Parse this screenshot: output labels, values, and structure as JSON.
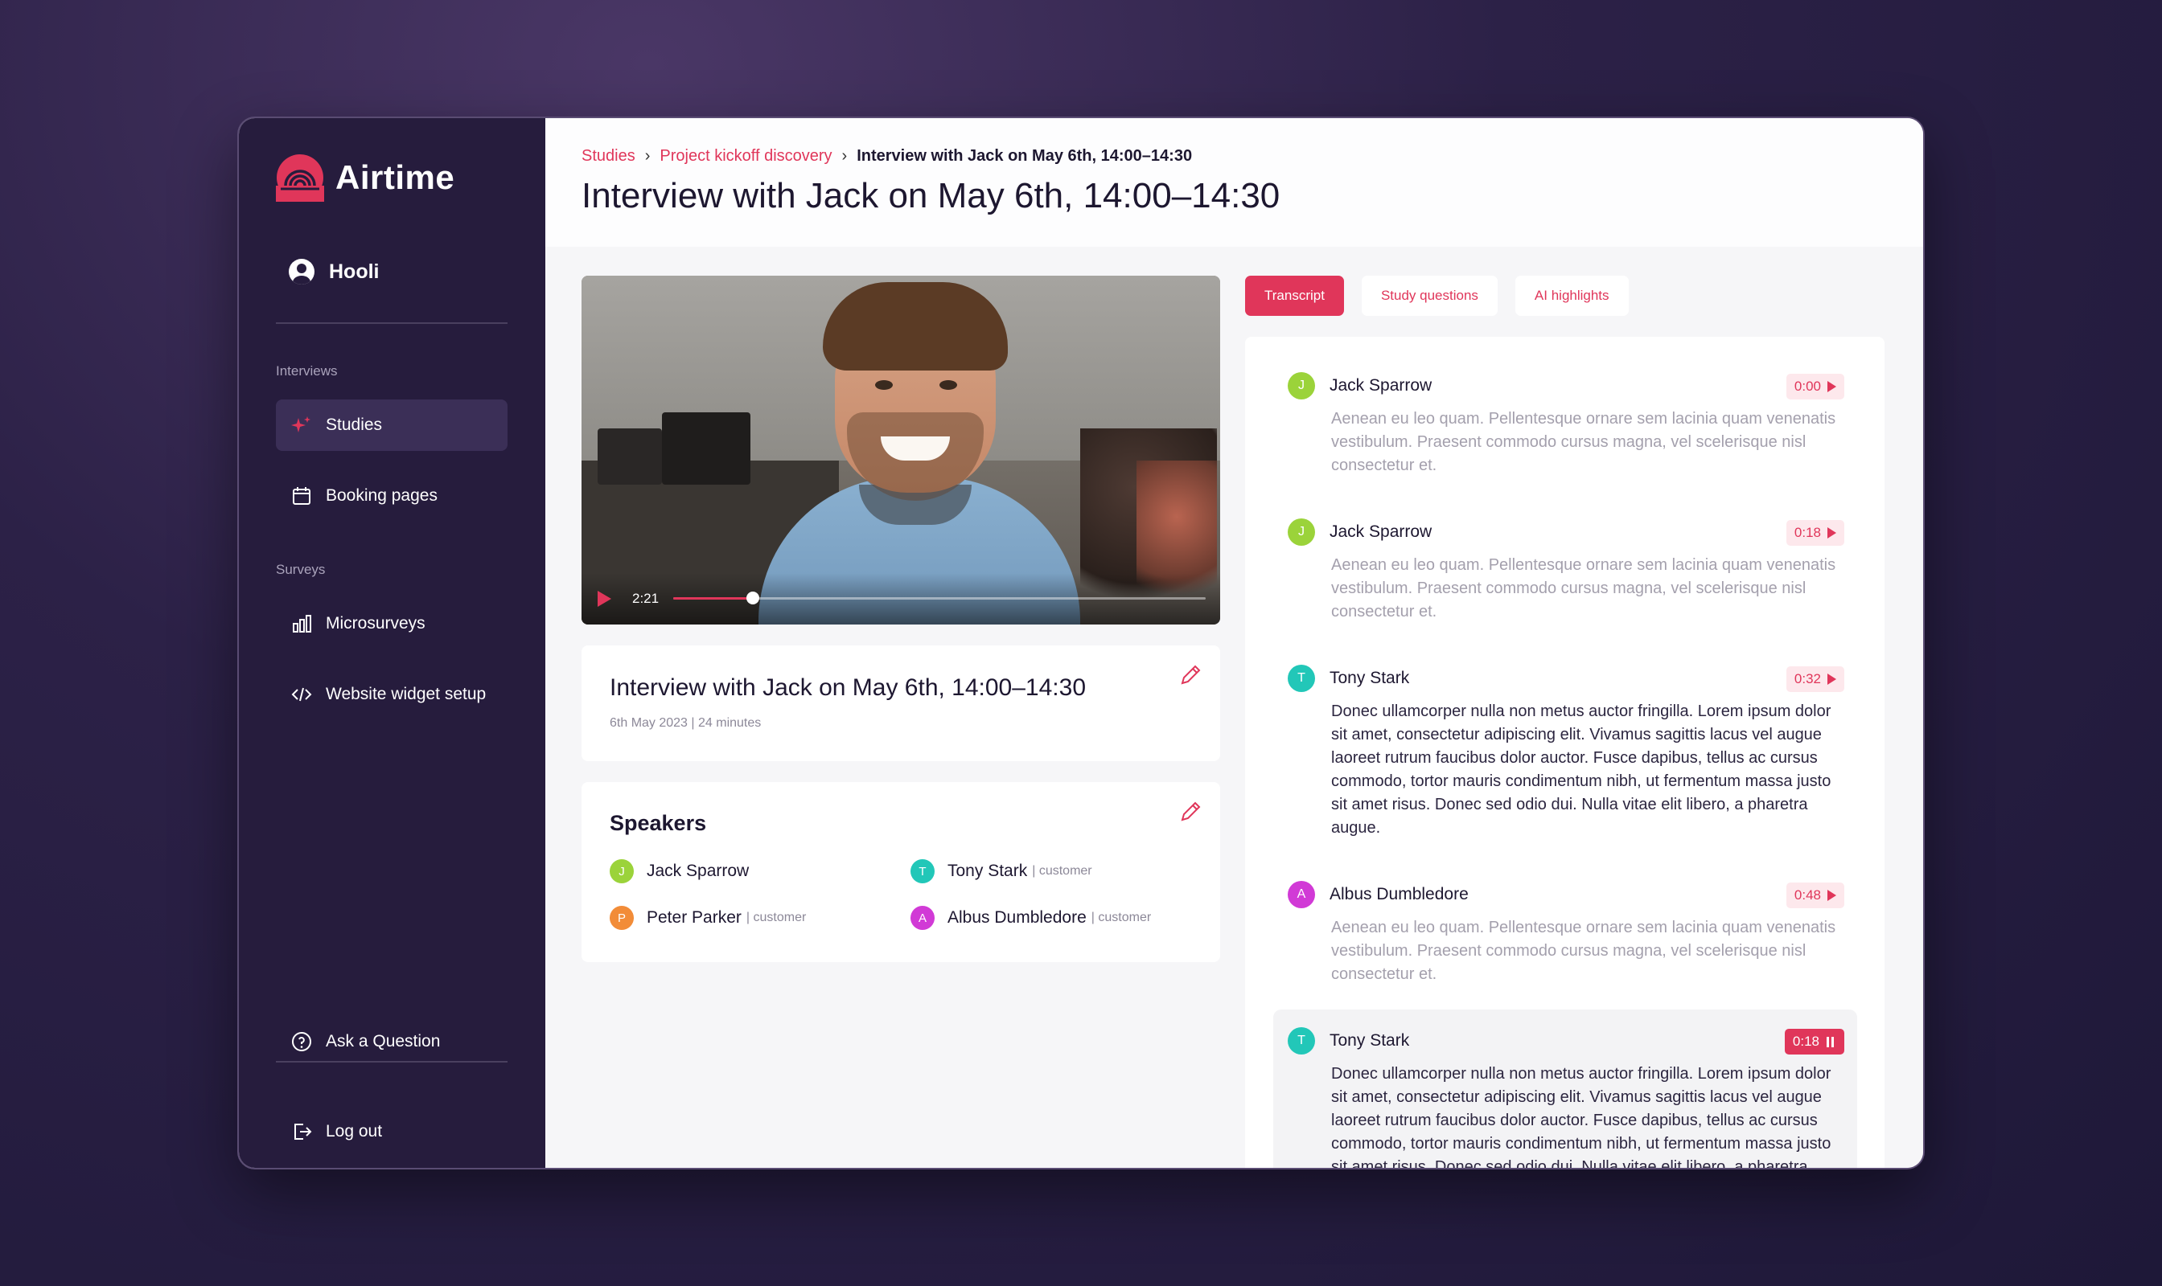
{
  "app": {
    "name": "Airtime",
    "brand_color": "#e0365a",
    "sidebar_color": "#261c3d"
  },
  "sidebar": {
    "org": "Hooli",
    "sections": [
      {
        "label": "Interviews",
        "items": [
          {
            "label": "Studies",
            "icon": "sparkle-icon",
            "active": true
          },
          {
            "label": "Booking pages",
            "icon": "calendar-icon"
          }
        ]
      },
      {
        "label": "Surveys",
        "items": [
          {
            "label": "Microsurveys",
            "icon": "bar-chart-icon"
          },
          {
            "label": "Website widget setup",
            "icon": "code-icon"
          }
        ]
      }
    ],
    "footer": {
      "ask": "Ask a Question",
      "logout": "Log out"
    }
  },
  "breadcrumb": {
    "items": [
      "Studies",
      "Project kickoff discovery"
    ],
    "current": "Interview with Jack on May 6th, 14:00–14:30"
  },
  "page": {
    "title": "Interview with Jack on May 6th, 14:00–14:30"
  },
  "video": {
    "current_time": "2:21",
    "progress": 0.15
  },
  "details": {
    "title": "Interview with Jack on May 6th, 14:00–14:30",
    "date": "6th May 2023",
    "duration": "24 minutes"
  },
  "speakers": {
    "title": "Speakers",
    "list": [
      {
        "initial": "J",
        "name": "Jack Sparrow",
        "role": "",
        "color": "#9bd33a"
      },
      {
        "initial": "T",
        "name": "Tony Stark",
        "role": "| customer",
        "color": "#22c7b8"
      },
      {
        "initial": "P",
        "name": "Peter Parker",
        "role": "| customer",
        "color": "#f28c38"
      },
      {
        "initial": "A",
        "name": "Albus Dumbledore",
        "role": "| customer",
        "color": "#d13ad6"
      }
    ]
  },
  "tabs": [
    "Transcript",
    "Study questions",
    "AI highlights"
  ],
  "transcript": [
    {
      "initial": "J",
      "name": "Jack Sparrow",
      "time": "0:00",
      "color": "#9bd33a",
      "text": "Aenean eu leo quam. Pellentesque ornare sem lacinia quam venenatis vestibulum. Praesent commodo cursus magna, vel scelerisque nisl consectetur et."
    },
    {
      "initial": "J",
      "name": "Jack Sparrow",
      "time": "0:18",
      "color": "#9bd33a",
      "text": "Aenean eu leo quam. Pellentesque ornare sem lacinia quam venenatis vestibulum. Praesent commodo cursus magna, vel scelerisque nisl consectetur et."
    },
    {
      "initial": "T",
      "name": "Tony Stark",
      "time": "0:32",
      "color": "#22c7b8",
      "text": "Donec ullamcorper nulla non metus auctor fringilla. Lorem ipsum dolor sit amet, consectetur adipiscing elit. Vivamus sagittis lacus vel augue laoreet rutrum faucibus dolor auctor. Fusce dapibus, tellus ac cursus commodo, tortor mauris condimentum nibh, ut fermentum massa justo sit amet risus. Donec sed odio dui. Nulla vitae elit libero, a pharetra augue."
    },
    {
      "initial": "A",
      "name": "Albus Dumbledore",
      "time": "0:48",
      "color": "#d13ad6",
      "text": "Aenean eu leo quam. Pellentesque ornare sem lacinia quam venenatis vestibulum. Praesent commodo cursus magna, vel scelerisque nisl consectetur et."
    },
    {
      "initial": "T",
      "name": "Tony Stark",
      "time": "0:18",
      "color": "#22c7b8",
      "text": "Donec ullamcorper nulla non metus auctor fringilla. Lorem ipsum dolor sit amet, consectetur adipiscing elit. Vivamus sagittis lacus vel augue laoreet rutrum faucibus dolor auctor. Fusce dapibus, tellus ac cursus commodo, tortor mauris condimentum nibh, ut fermentum massa justo sit amet risus. Donec sed odio dui. Nulla vitae elit libero, a pharetra augue."
    }
  ]
}
